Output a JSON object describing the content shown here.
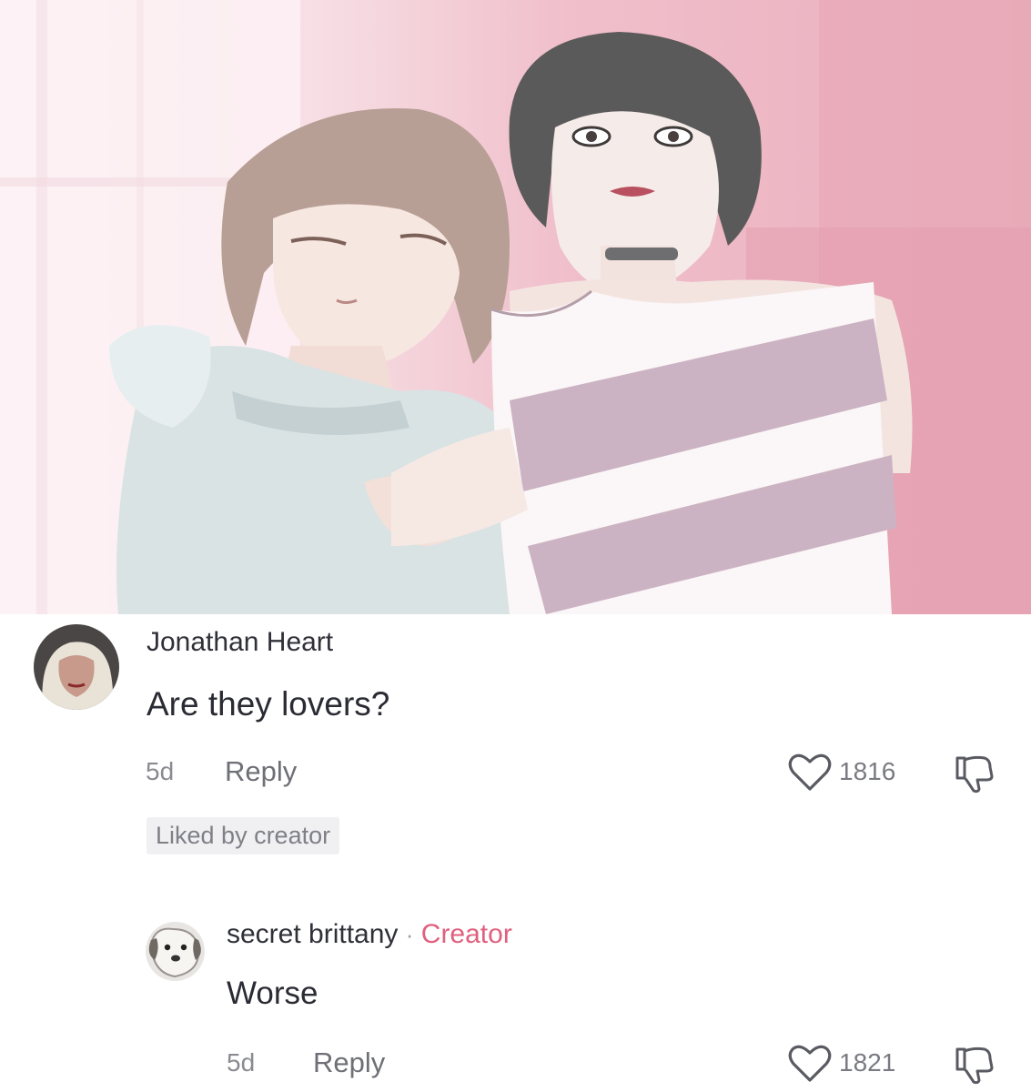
{
  "post": {
    "image_alt": "Anime illustration of two women against a pink background"
  },
  "comments": [
    {
      "author": "Jonathan Heart",
      "text": "Are they lovers?",
      "time": "5d",
      "reply_label": "Reply",
      "likes": "1816",
      "badge": "Liked by creator"
    }
  ],
  "reply": {
    "author": "secret brittany",
    "separator": "·",
    "creator_label": "Creator",
    "text": "Worse",
    "time": "5d",
    "reply_label": "Reply",
    "likes": "1821"
  },
  "colors": {
    "creator_accent": "#e0607e",
    "meta_gray": "#8a8b91",
    "pink_background": "#eaaebc"
  },
  "icons": [
    "heart-outline-icon",
    "thumbs-down-outline-icon"
  ]
}
